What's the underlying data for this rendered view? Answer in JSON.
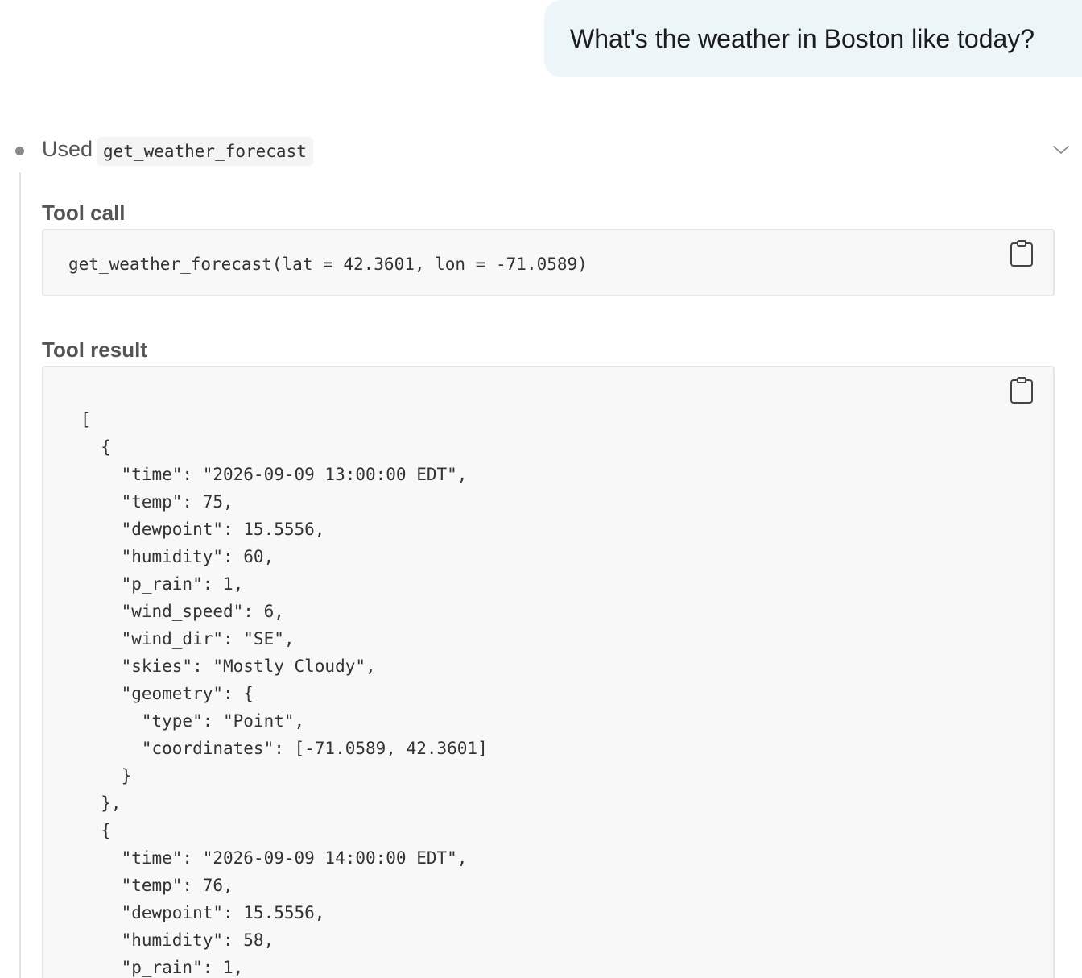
{
  "user_message": {
    "text": "What's the weather in Boston like today?"
  },
  "tool_usage": {
    "used_label": "Used",
    "tool_name": "get_weather_forecast",
    "expand_icon": "chevron-down-icon",
    "tool_call": {
      "heading": "Tool call",
      "code": "get_weather_forecast(lat = 42.3601, lon = -71.0589)",
      "copy_icon": "clipboard-icon"
    },
    "tool_result": {
      "heading": "Tool result",
      "copy_icon": "clipboard-icon",
      "lines": [
        "[",
        "  {",
        "    \"time\": \"2026-09-09 13:00:00 EDT\",",
        "    \"temp\": 75,",
        "    \"dewpoint\": 15.5556,",
        "    \"humidity\": 60,",
        "    \"p_rain\": 1,",
        "    \"wind_speed\": 6,",
        "    \"wind_dir\": \"SE\",",
        "    \"skies\": \"Mostly Cloudy\",",
        "    \"geometry\": {",
        "      \"type\": \"Point\",",
        "      \"coordinates\": [-71.0589, 42.3601]",
        "    }",
        "  },",
        "  {",
        "    \"time\": \"2026-09-09 14:00:00 EDT\",",
        "    \"temp\": 76,",
        "    \"dewpoint\": 15.5556,",
        "    \"humidity\": 58,",
        "    \"p_rain\": 1,"
      ]
    }
  },
  "colors": {
    "user_bubble_bg": "#ecf5f8",
    "code_bg": "#f8f8f8",
    "code_border": "#e6e6e6",
    "muted_text": "#555555"
  }
}
